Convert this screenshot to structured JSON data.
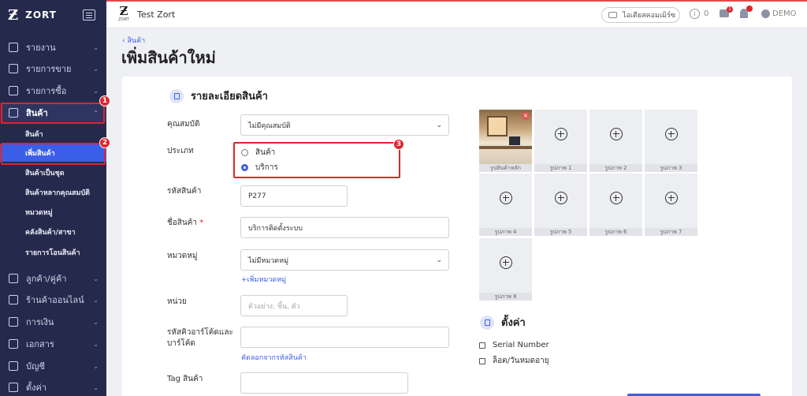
{
  "sidebar": {
    "brand_mark": "Ƶ",
    "brand": "ZORT",
    "items": [
      {
        "label": "รายงาน",
        "icon": "chart-icon"
      },
      {
        "label": "รายการขาย",
        "icon": "clipboard-icon"
      },
      {
        "label": "รายการซื้อ",
        "icon": "basket-icon"
      },
      {
        "label": "สินค้า",
        "icon": "box-icon"
      },
      {
        "label": "ลูกค้า/คู่ค้า",
        "icon": "users-icon"
      },
      {
        "label": "ร้านค้าออนไลน์",
        "icon": "store-icon"
      },
      {
        "label": "การเงิน",
        "icon": "money-icon"
      },
      {
        "label": "เอกสาร",
        "icon": "document-icon"
      },
      {
        "label": "บัญชี",
        "icon": "book-icon"
      },
      {
        "label": "ตั้งค่า",
        "icon": "gear-icon"
      }
    ],
    "subitems": [
      "สินค้า",
      "เพิ่มสินค้า",
      "สินค้าเป็นชุด",
      "สินค้าหลากคุณสมบัติ",
      "หมวดหมู่",
      "คลังสินค้า/สาขา",
      "รายการโอนสินค้า"
    ],
    "chevron": "⌄",
    "chevron_up": "⌃"
  },
  "annotations": {
    "one": "1",
    "two": "2",
    "three": "3"
  },
  "topbar": {
    "logo_mark": "Ƶ",
    "logo_small": "ZORT",
    "company": "Test Zort",
    "suggest_label": "ไอเดียสคอมเมิร์ซ",
    "info_icon": "i",
    "info_count": "0",
    "chat_badge": "1",
    "user": "DEMO"
  },
  "page": {
    "breadcrumb": "‹ สินค้า",
    "title": "เพิ่มสินค้าใหม่"
  },
  "form": {
    "section_title": "รายละเอียดสินค้า",
    "attribute_label": "คุณสมบัติ",
    "attribute_value": "ไม่มีคุณสมบัติ",
    "type_label": "ประเภท",
    "type_options": [
      "สินค้า",
      "บริการ"
    ],
    "type_selected": "บริการ",
    "sku_label": "รหัสสินค้า",
    "sku_value": "P277",
    "name_label": "ชื่อสินค้า",
    "name_required": "*",
    "name_value": "บริการติดตั้งระบบ",
    "category_label": "หมวดหมู่",
    "category_value": "ไม่มีหมวดหมู่",
    "add_category": "+เพิ่มหมวดหมู่",
    "unit_label": "หน่วย",
    "unit_placeholder": "ตัวอย่าง: ชิ้น, ตัว",
    "barcode_label_1": "รหัสคิวอาร์โค้ดและ",
    "barcode_label_2": "บาร์โค้ด",
    "copy_link": "คัดลอกจากรหัสสินค้า",
    "tag_label": "Tag สินค้า",
    "caret": "⌄"
  },
  "images": {
    "remove_icon": "×",
    "captions": [
      "รูปสินค้าหลัก",
      "รูปภาพ 1",
      "รูปภาพ 2",
      "รูปภาพ 3",
      "รูปภาพ 4",
      "รูปภาพ 5",
      "รูปภาพ 6",
      "รูปภาพ 7",
      "รูปภาพ 8"
    ]
  },
  "settings": {
    "title": "ตั้งค่า",
    "options": [
      "Serial Number",
      "ล็อต/วันหมดอายุ"
    ]
  },
  "colors": {
    "primary": "#3b5ee8",
    "sidebar": "#252a4d",
    "highlight": "#e0242c"
  }
}
